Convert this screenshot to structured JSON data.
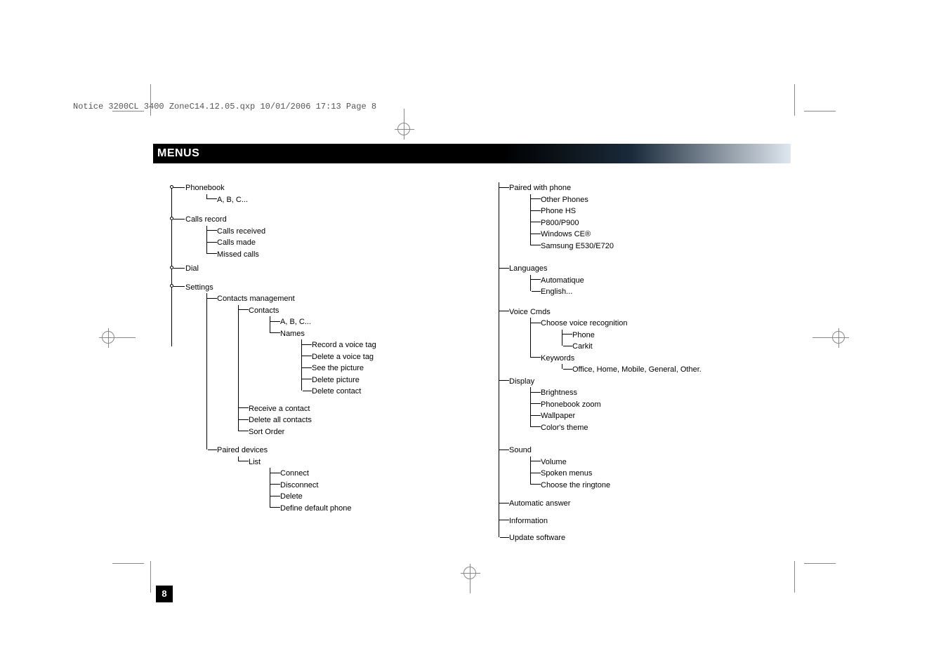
{
  "header_text": "Notice 3200CL 3400 ZoneC14.12.05.qxp  10/01/2006  17:13  Page 8",
  "title": "MENUS",
  "page_number": "8",
  "roots": {
    "phonebook": {
      "label": "Phonebook",
      "abc": "A, B, C..."
    },
    "calls_record": {
      "label": "Calls record",
      "received": "Calls received",
      "made": "Calls made",
      "missed": "Missed calls"
    },
    "dial": {
      "label": "Dial"
    },
    "settings": {
      "label": "Settings",
      "contacts_mgmt": {
        "label": "Contacts management",
        "contacts": {
          "label": "Contacts",
          "abc": "A, B, C...",
          "names": {
            "label": "Names",
            "record": "Record a voice tag",
            "delete_tag": "Delete a voice tag",
            "see_pic": "See the picture",
            "delete_pic": "Delete picture",
            "delete_contact": "Delete contact"
          }
        },
        "receive": "Receive a contact",
        "delete_all": "Delete all contacts",
        "sort": "Sort Order"
      },
      "paired_devices": {
        "label": "Paired devices",
        "list": {
          "label": "List",
          "connect": "Connect",
          "disconnect": "Disconnect",
          "delete": "Delete",
          "define": "Define default phone"
        }
      },
      "paired_with_phone": {
        "label": "Paired with phone",
        "other": "Other Phones",
        "hs": "Phone HS",
        "p800": "P800/P900",
        "wince": "Windows CE®",
        "samsung": "Samsung E530/E720"
      },
      "languages": {
        "label": "Languages",
        "auto": "Automatique",
        "english": "English..."
      },
      "voice_cmds": {
        "label": "Voice Cmds",
        "choose": {
          "label": "Choose voice recognition",
          "phone": "Phone",
          "carkit": "Carkit"
        },
        "keywords": {
          "label": "Keywords",
          "list": "Office, Home, Mobile, General, Other."
        }
      },
      "display": {
        "label": "Display",
        "brightness": "Brightness",
        "zoom": "Phonebook zoom",
        "wallpaper": "Wallpaper",
        "theme": "Color's theme"
      },
      "sound": {
        "label": "Sound",
        "volume": "Volume",
        "spoken": "Spoken menus",
        "ringtone": "Choose the ringtone"
      },
      "auto_answer": {
        "label": "Automatic answer"
      },
      "information": {
        "label": "Information"
      },
      "update": {
        "label": "Update software"
      }
    }
  }
}
